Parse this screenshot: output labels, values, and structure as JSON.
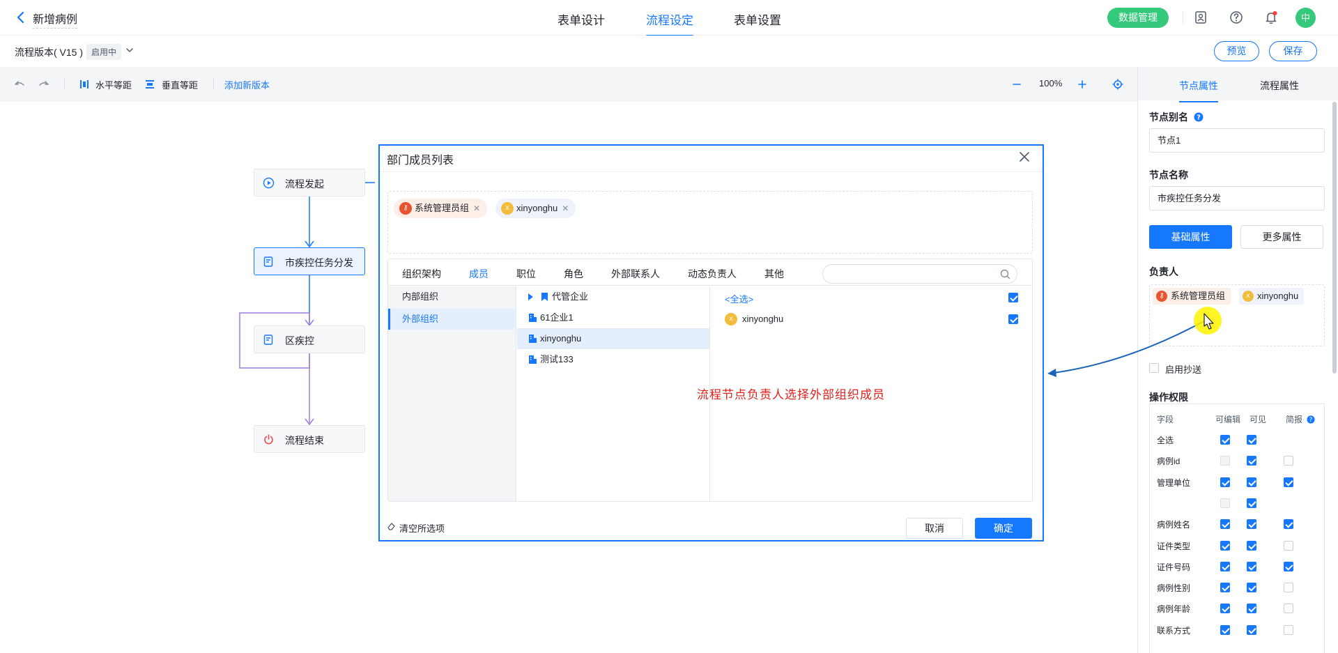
{
  "header": {
    "title": "新增病例",
    "tabs": [
      {
        "label": "表单设计",
        "active": false
      },
      {
        "label": "流程设定",
        "active": true
      },
      {
        "label": "表单设置",
        "active": false
      }
    ],
    "data_button": "数据管理",
    "avatar": "中",
    "icons": [
      "contact-icon",
      "help-icon",
      "bell-icon"
    ]
  },
  "version_bar": {
    "label": "流程版本( V15 )",
    "status": "启用中",
    "preview": "预览",
    "save": "保存"
  },
  "toolbar": {
    "horizontal": "水平等距",
    "vertical": "垂直等距",
    "add_version": "添加新版本",
    "zoom": "100%"
  },
  "flow": {
    "nodes": [
      {
        "label": "流程发起",
        "icon": "play-icon"
      },
      {
        "label": "市疾控任务分发",
        "icon": "form-icon",
        "active": true
      },
      {
        "label": "区疾控",
        "icon": "form-icon"
      },
      {
        "label": "流程结束",
        "icon": "power-icon"
      }
    ]
  },
  "right_panel": {
    "tabs": [
      {
        "label": "节点属性",
        "active": true
      },
      {
        "label": "流程属性",
        "active": false
      }
    ],
    "alias_label": "节点别名",
    "alias_value": "节点1",
    "name_label": "节点名称",
    "name_value": "市疾控任务分发",
    "basic_btn": "基础属性",
    "more_btn": "更多属性",
    "assignee_label": "负责人",
    "assignees": [
      {
        "name": "系统管理员组",
        "type": "group"
      },
      {
        "name": "xinyonghu",
        "type": "user",
        "initial": "x"
      }
    ],
    "cc_label": "启用抄送",
    "perm_label": "操作权限",
    "perm_headers": {
      "field": "字段",
      "editable": "可编辑",
      "visible": "可见",
      "report": "简报"
    },
    "perm_rows": [
      {
        "label": "全选",
        "editable": "on",
        "visible": "on",
        "report": "none"
      },
      {
        "label": "病例id",
        "editable": "dis",
        "visible": "on",
        "report": "off"
      },
      {
        "label": "管理单位",
        "editable": "on",
        "visible": "on",
        "report": "on"
      },
      {
        "label": "",
        "editable": "dis",
        "visible": "on",
        "report": "none"
      },
      {
        "label": "病例姓名",
        "editable": "on",
        "visible": "on",
        "report": "on"
      },
      {
        "label": "证件类型",
        "editable": "on",
        "visible": "on",
        "report": "off"
      },
      {
        "label": "证件号码",
        "editable": "on",
        "visible": "on",
        "report": "on"
      },
      {
        "label": "病例性别",
        "editable": "on",
        "visible": "on",
        "report": "off"
      },
      {
        "label": "病例年龄",
        "editable": "on",
        "visible": "on",
        "report": "off"
      },
      {
        "label": "联系方式",
        "editable": "on",
        "visible": "on",
        "report": "off"
      }
    ]
  },
  "modal": {
    "title": "部门成员列表",
    "selected": [
      {
        "name": "系统管理员组",
        "type": "group"
      },
      {
        "name": "xinyonghu",
        "type": "user",
        "initial": "x"
      }
    ],
    "tabs": [
      {
        "label": "组织架构",
        "active": false
      },
      {
        "label": "成员",
        "active": true
      },
      {
        "label": "职位",
        "active": false
      },
      {
        "label": "角色",
        "active": false
      },
      {
        "label": "外部联系人",
        "active": false
      },
      {
        "label": "动态负责人",
        "active": false
      },
      {
        "label": "其他",
        "active": false
      }
    ],
    "search_placeholder": "",
    "col1": [
      {
        "label": "内部组织",
        "selected": false
      },
      {
        "label": "外部组织",
        "selected": true
      }
    ],
    "col2": [
      {
        "label": "代管企业",
        "kind": "root"
      },
      {
        "label": "61企业1",
        "kind": "org"
      },
      {
        "label": "xinyonghu",
        "kind": "org",
        "selected": true
      },
      {
        "label": "测试133",
        "kind": "org"
      }
    ],
    "select_all": "<全选>",
    "members": [
      {
        "name": "xinyonghu",
        "initial": "x",
        "checked": true
      }
    ],
    "annotation": "流程节点负责人选择外部组织成员",
    "clear": "清空所选项",
    "cancel": "取消",
    "ok": "确定"
  },
  "colors": {
    "primary": "#1677ff",
    "green": "#34c97b",
    "annotation": "#e0201d",
    "highlight": "#fff200"
  }
}
